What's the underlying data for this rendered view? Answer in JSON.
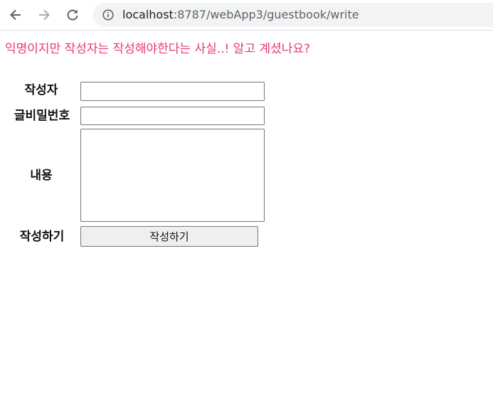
{
  "browser": {
    "url_host": "localhost",
    "url_rest": ":8787/webApp3/guestbook/write"
  },
  "notice": "익명이지만 작성자는 작성해야한다는 사실..! 알고 계셨나요?",
  "form": {
    "writer_label": "작성자",
    "writer_value": "",
    "password_label": "글비밀번호",
    "password_value": "",
    "content_label": "내용",
    "content_value": "",
    "submit_row_label": "작성하기",
    "submit_button_label": "작성하기"
  }
}
